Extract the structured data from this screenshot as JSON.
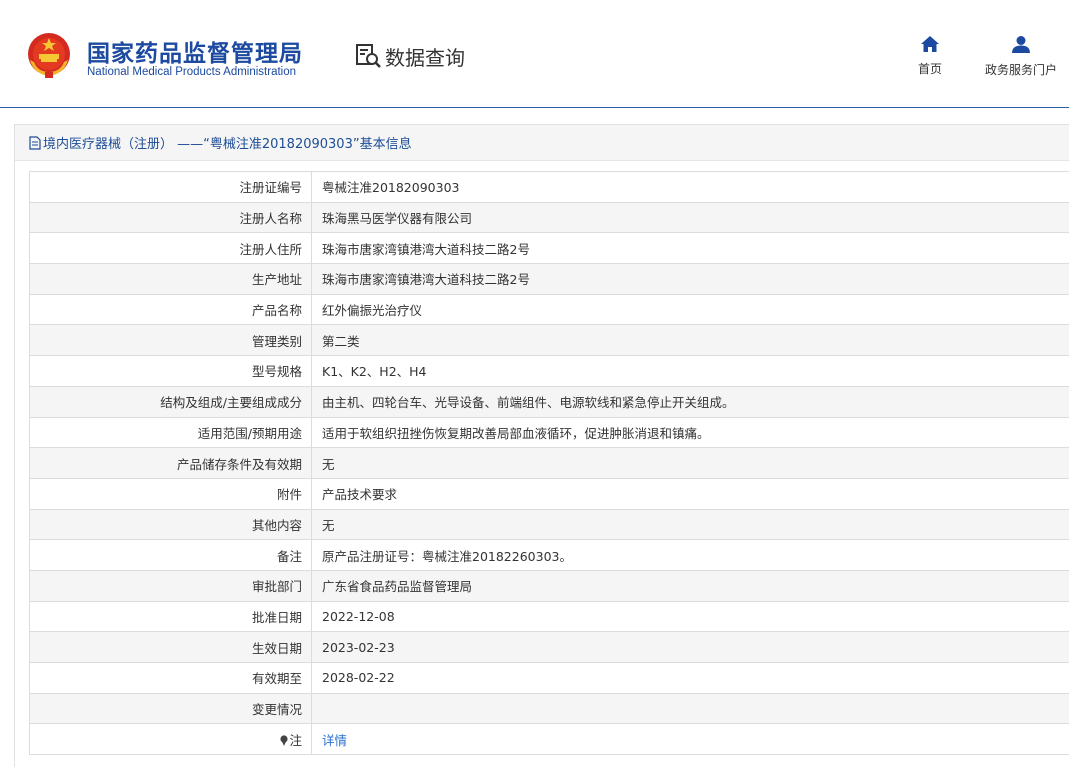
{
  "header": {
    "logo_cn": "国家药品监督管理局",
    "logo_en": "National Medical Products Administration",
    "section_title": "数据查询",
    "nav": [
      {
        "label": "首页",
        "icon": "home-icon"
      },
      {
        "label": "政务服务门户",
        "icon": "user-icon"
      }
    ]
  },
  "colors": {
    "brand": "#1c4aa0",
    "accent_line": "#2a5ea8",
    "link": "#2a6fcf"
  },
  "panel": {
    "title": "境内医疗器械（注册） ——“粤械注准20182090303”基本信息"
  },
  "rows": [
    {
      "label": "注册证编号",
      "value": "粤械注准20182090303"
    },
    {
      "label": "注册人名称",
      "value": "珠海黑马医学仪器有限公司"
    },
    {
      "label": "注册人住所",
      "value": "珠海市唐家湾镇港湾大道科技二路2号"
    },
    {
      "label": "生产地址",
      "value": "珠海市唐家湾镇港湾大道科技二路2号"
    },
    {
      "label": "产品名称",
      "value": "红外偏振光治疗仪"
    },
    {
      "label": "管理类别",
      "value": "第二类"
    },
    {
      "label": "型号规格",
      "value": "K1、K2、H2、H4"
    },
    {
      "label": "结构及组成/主要组成成分",
      "value": "由主机、四轮台车、光导设备、前端组件、电源软线和紧急停止开关组成。"
    },
    {
      "label": "适用范围/预期用途",
      "value": "适用于软组织扭挫伤恢复期改善局部血液循环，促进肿胀消退和镇痛。"
    },
    {
      "label": "产品储存条件及有效期",
      "value": "无"
    },
    {
      "label": "附件",
      "value": "产品技术要求"
    },
    {
      "label": "其他内容",
      "value": "无"
    },
    {
      "label": "备注",
      "value": "原产品注册证号：粤械注准20182260303。"
    },
    {
      "label": "审批部门",
      "value": "广东省食品药品监督管理局"
    },
    {
      "label": "批准日期",
      "value": "2022-12-08"
    },
    {
      "label": "生效日期",
      "value": "2023-02-23"
    },
    {
      "label": "有效期至",
      "value": "2028-02-22"
    },
    {
      "label": "变更情况",
      "value": ""
    }
  ],
  "note_row": {
    "label": "注",
    "link": "详情"
  }
}
